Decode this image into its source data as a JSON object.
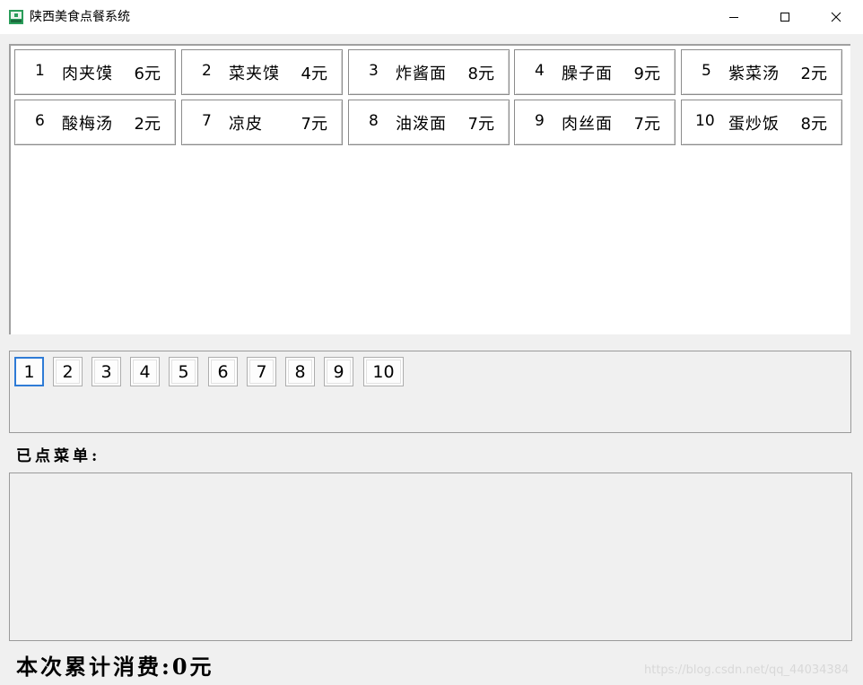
{
  "window": {
    "title": "陕西美食点餐系统",
    "app_icon": "app-icon",
    "controls": {
      "minimize": "minimize-icon",
      "maximize": "maximize-icon",
      "close": "close-icon"
    }
  },
  "menu": {
    "dishes": [
      {
        "num": "1",
        "name": "肉夹馍",
        "price": "6元"
      },
      {
        "num": "2",
        "name": "菜夹馍",
        "price": "4元"
      },
      {
        "num": "3",
        "name": "炸酱面",
        "price": "8元"
      },
      {
        "num": "4",
        "name": "臊子面",
        "price": "9元"
      },
      {
        "num": "5",
        "name": "紫菜汤",
        "price": "2元"
      },
      {
        "num": "6",
        "name": "酸梅汤",
        "price": "2元"
      },
      {
        "num": "7",
        "name": "凉皮",
        "price": "7元"
      },
      {
        "num": "8",
        "name": "油泼面",
        "price": "7元"
      },
      {
        "num": "9",
        "name": "肉丝面",
        "price": "7元"
      },
      {
        "num": "10",
        "name": "蛋炒饭",
        "price": "8元"
      }
    ]
  },
  "selection": {
    "buttons": [
      "1",
      "2",
      "3",
      "4",
      "5",
      "6",
      "7",
      "8",
      "9",
      "10"
    ],
    "focused": "1"
  },
  "ordered": {
    "label": "已点菜单:",
    "items": []
  },
  "summary": {
    "total": "本次累计消费:0元"
  },
  "watermark": "https://blog.csdn.net/qq_44034384",
  "colors": {
    "focus_border": "#2e7bd6",
    "window_bg": "#f0f0f0"
  }
}
